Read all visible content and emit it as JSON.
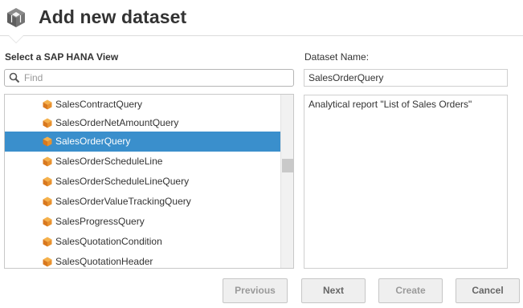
{
  "header": {
    "title": "Add new dataset",
    "logo_icon": "cube-stack-icon"
  },
  "left_panel": {
    "label": "Select a SAP HANA View",
    "search": {
      "placeholder": "Find",
      "value": ""
    },
    "items": [
      {
        "label": "SalesContractQuery",
        "selected": false
      },
      {
        "label": "SalesOrderNetAmountQuery",
        "selected": false
      },
      {
        "label": "SalesOrderQuery",
        "selected": true
      },
      {
        "label": "SalesOrderScheduleLine",
        "selected": false
      },
      {
        "label": "SalesOrderScheduleLineQuery",
        "selected": false
      },
      {
        "label": "SalesOrderValueTrackingQuery",
        "selected": false
      },
      {
        "label": "SalesProgressQuery",
        "selected": false
      },
      {
        "label": "SalesQuotationCondition",
        "selected": false
      },
      {
        "label": "SalesQuotationHeader",
        "selected": false
      }
    ]
  },
  "right_panel": {
    "name_label": "Dataset Name:",
    "name_value": "SalesOrderQuery",
    "description": "Analytical report \"List of Sales Orders\""
  },
  "buttons": {
    "previous": "Previous",
    "next": "Next",
    "create": "Create",
    "cancel": "Cancel"
  },
  "colors": {
    "selection": "#3a8fcc",
    "cube_orange": "#e8912e"
  }
}
